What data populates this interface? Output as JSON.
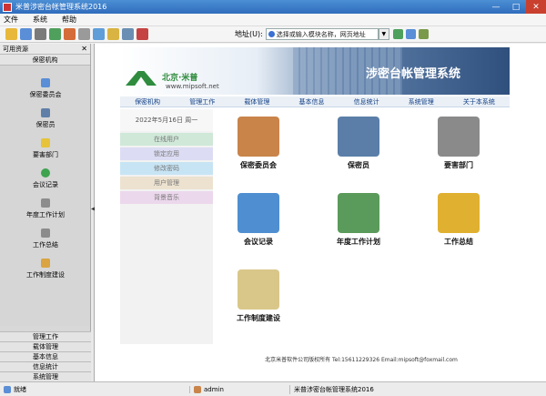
{
  "window": {
    "title": "米普涉密台帐管理系统2016",
    "minimize": "—",
    "maximize": "□",
    "close": "✕"
  },
  "menu": {
    "file": "文件",
    "system": "系统",
    "help": "帮助"
  },
  "toolbar": {
    "address_label": "地址(U):",
    "address_value": "选择或输入模块名称，网页地址",
    "combo": "▼"
  },
  "left_panel": {
    "header": "可用资源",
    "close": "✕",
    "section": "保密机构",
    "items": [
      {
        "label": "保密委员会",
        "color": "#5a8ed6"
      },
      {
        "label": "保密员",
        "color": "#5f7fa8"
      },
      {
        "label": "要害部门",
        "color": "#e6c33b"
      },
      {
        "label": "会议记录",
        "color": "#3da34f"
      },
      {
        "label": "年度工作计划",
        "color": "#8c8c8c"
      },
      {
        "label": "工作总结",
        "color": "#8c8c8c"
      },
      {
        "label": "工作制度建设",
        "color": "#d9a441"
      }
    ],
    "bottom_sections": [
      "管理工作",
      "载体管理",
      "基本信息",
      "信息统计",
      "系统管理"
    ]
  },
  "main": {
    "brand": "北京·米普",
    "site": "www.mipsoft.net",
    "system_title": "涉密台帐管理系统",
    "nav": [
      "保密机构",
      "管理工作",
      "载体管理",
      "基本信息",
      "信息统计",
      "系统管理",
      "关于本系统"
    ],
    "date": "2022年5月16日 周一",
    "quick_buttons": [
      {
        "label": "在线用户",
        "color": "#cfe8d8"
      },
      {
        "label": "锁定应用",
        "color": "#dcdcf4"
      },
      {
        "label": "修改密码",
        "color": "#c7e4f4"
      },
      {
        "label": "用户管理",
        "color": "#ece2cf"
      },
      {
        "label": "背景音乐",
        "color": "#ecd8ec"
      }
    ],
    "grid": [
      {
        "label": "保密委员会",
        "color": "#c9844a"
      },
      {
        "label": "保密员",
        "color": "#5a7ea8"
      },
      {
        "label": "要害部门",
        "color": "#8a8a8a"
      },
      {
        "label": "会议记录",
        "color": "#4f8fd1"
      },
      {
        "label": "年度工作计划",
        "color": "#5a9a5a"
      },
      {
        "label": "工作总结",
        "color": "#e0b030"
      },
      {
        "label": "工作制度建设",
        "color": "#d9c78a"
      }
    ],
    "footer": "北京米普软件公司版权所有  Tel:15611229326  Email:mipsoft@foxmail.com"
  },
  "status": {
    "ready": "就绪",
    "user": "admin",
    "app": "米普涉密台帐管理系统2016"
  }
}
